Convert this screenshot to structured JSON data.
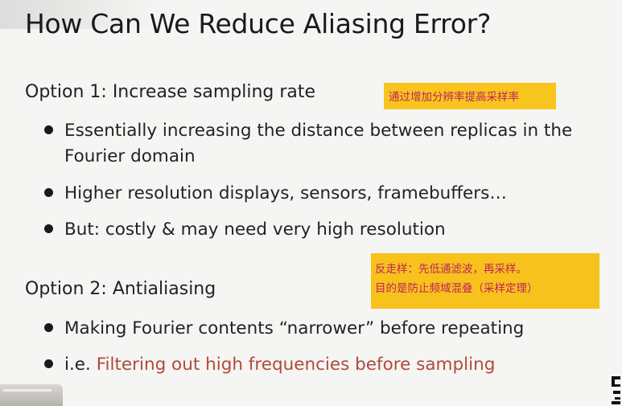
{
  "slide": {
    "title": "How Can We Reduce Aliasing Error?",
    "option1": {
      "heading": "Option 1: Increase sampling rate",
      "bullets": [
        {
          "line1": "Essentially increasing the distance between replicas in the",
          "line2": "Fourier domain"
        },
        {
          "line1": "Higher resolution displays, sensors, framebuffers…"
        },
        {
          "line1": "But: costly & may need very high resolution"
        }
      ]
    },
    "option2": {
      "heading": "Option 2: Antialiasing",
      "bullets": [
        {
          "line1": "Making Fourier contents “narrower” before repeating"
        },
        {
          "prefix": "i.e. ",
          "highlight": "Filtering out high frequencies before sampling"
        }
      ]
    }
  },
  "annotations": {
    "note1": "通过增加分辨率提高采样率",
    "note2_line1": "反走样：先低通滤波，再采样。",
    "note2_line2": "目的是防止频域混叠（采样定理）"
  },
  "colors": {
    "background": "#f5f5f3",
    "text": "#222222",
    "highlight_red": "#b04a3a",
    "note_bg": "#f7c21c",
    "note_text": "#c0225e"
  }
}
